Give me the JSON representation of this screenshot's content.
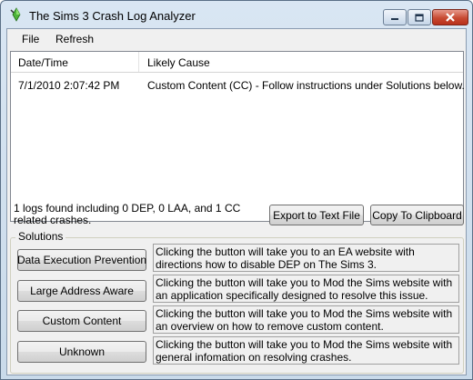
{
  "window": {
    "title": "The Sims 3 Crash Log Analyzer"
  },
  "menu": {
    "file": "File",
    "refresh": "Refresh"
  },
  "list": {
    "headers": [
      "Date/Time",
      "Likely Cause"
    ],
    "rows": [
      {
        "date": "7/1/2010 2:07:42 PM",
        "cause": "Custom Content (CC) - Follow instructions under Solutions below."
      }
    ]
  },
  "status": {
    "text": "1 logs found including 0 DEP, 0 LAA, and 1 CC related crashes."
  },
  "buttons": {
    "export": "Export to Text File",
    "copy": "Copy To Clipboard"
  },
  "solutions": {
    "label": "Solutions",
    "items": [
      {
        "button": "Data Execution Prevention",
        "description": "Clicking the button will take you to an EA website with directions how to disable DEP on The Sims 3."
      },
      {
        "button": "Large Address Aware",
        "description": "Clicking the button will take you to Mod the Sims website with an application specifically designed to resolve this issue."
      },
      {
        "button": "Custom Content",
        "description": "Clicking the button will take you to Mod the Sims website with an overview on how to remove custom content."
      },
      {
        "button": "Unknown",
        "description": "Clicking the button will take you to Mod the Sims website with general infomation on resolving crashes."
      }
    ]
  }
}
